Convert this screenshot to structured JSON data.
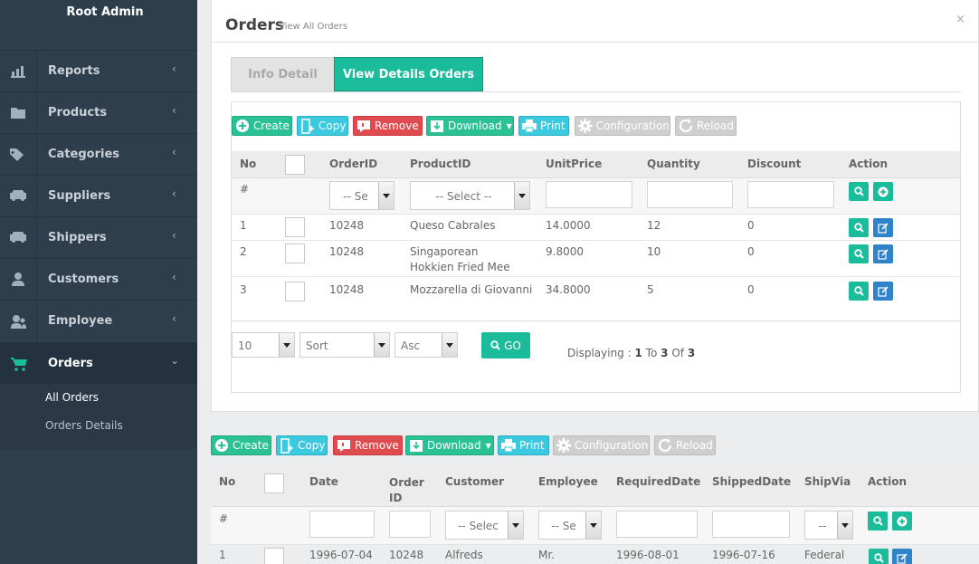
{
  "sidebar": {
    "brand": "Root Admin",
    "items": [
      {
        "label": "Reports",
        "icon": "chart-icon"
      },
      {
        "label": "Products",
        "icon": "folder-icon"
      },
      {
        "label": "Categories",
        "icon": "tag-icon"
      },
      {
        "label": "Suppliers",
        "icon": "truck-icon"
      },
      {
        "label": "Shippers",
        "icon": "truck-icon"
      },
      {
        "label": "Customers",
        "icon": "user-icon"
      },
      {
        "label": "Employee",
        "icon": "users-icon"
      },
      {
        "label": "Orders",
        "icon": "cart-icon",
        "active": true
      }
    ],
    "submenu": [
      "All Orders",
      "Orders Details"
    ]
  },
  "panel": {
    "title": "Orders",
    "subtitle": "View All Orders",
    "close": "×",
    "tabs": [
      "Info Detail",
      "View Details Orders"
    ]
  },
  "toolbar": {
    "create": "Create",
    "copy": "Copy",
    "remove": "Remove",
    "download": "Download",
    "print": "Print",
    "configuration": "Configuration",
    "reload": "Reload"
  },
  "details_grid": {
    "columns": [
      "No",
      "OrderID",
      "ProductID",
      "UnitPrice",
      "Quantity",
      "Discount",
      "Action"
    ],
    "filter": {
      "no": "#",
      "order_select": "-- Se",
      "product_select": "-- Select --"
    },
    "rows": [
      {
        "no": "1",
        "order_id": "10248",
        "product": "Queso Cabrales",
        "unit_price": "14.0000",
        "quantity": "12",
        "discount": "0"
      },
      {
        "no": "2",
        "order_id": "10248",
        "product": "Singaporean Hokkien Fried Mee",
        "unit_price": "9.8000",
        "quantity": "10",
        "discount": "0"
      },
      {
        "no": "3",
        "order_id": "10248",
        "product": "Mozzarella di Giovanni",
        "unit_price": "34.8000",
        "quantity": "5",
        "discount": "0"
      }
    ],
    "pager": {
      "page_size": "10",
      "sort": "Sort",
      "order": "Asc",
      "go": "GO",
      "display_label": "Displaying :",
      "from": "1",
      "to_label": "To",
      "to": "3",
      "of_label": "Of",
      "total": "3"
    }
  },
  "orders_grid": {
    "columns": [
      "No",
      "Date",
      "Order ID",
      "Customer",
      "Employee",
      "RequiredDate",
      "ShippedDate",
      "ShipVia",
      "Action"
    ],
    "filter": {
      "no": "#",
      "customer_select": "-- Selec",
      "employee_select": "-- Se",
      "shipvia_select": "--"
    },
    "rows": [
      {
        "no": "1",
        "date": "1996-07-04",
        "order_id": "10248",
        "customer": "Alfreds",
        "employee": "Mr.",
        "required": "1996-08-01",
        "shipped": "1996-07-16",
        "ship_via": "Federal"
      }
    ]
  },
  "colors": {
    "accent": "#1abc9c",
    "sidebar": "#2f3e4d",
    "danger": "#e04b50",
    "info": "#3bc9e0",
    "edit": "#2f83c8"
  }
}
